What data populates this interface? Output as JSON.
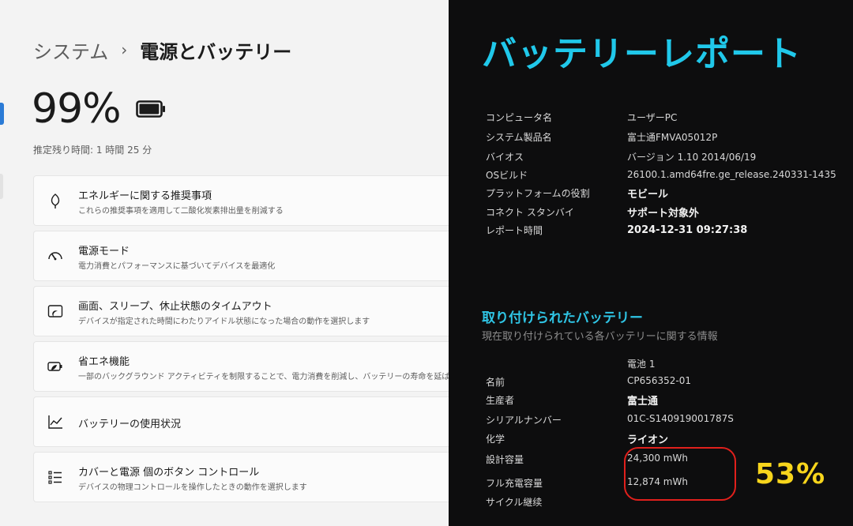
{
  "settings": {
    "breadcrumb": {
      "parent": "システム",
      "separator": "›",
      "current": "電源とバッテリー"
    },
    "battery_percent": "99%",
    "battery_level": 0.99,
    "estimated_remaining": "推定残り時間: 1 時間 25 分",
    "cards": [
      {
        "title": "エネルギーに関する推奨事項",
        "subtitle": "これらの推奨事項を適用して二酸化炭素排出量を削減する",
        "icon": "leaf-icon"
      },
      {
        "title": "電源モード",
        "subtitle": "電力消費とパフォーマンスに基づいてデバイスを最適化",
        "icon": "power-mode-gauge-icon"
      },
      {
        "title": "画面、スリープ、休止状態のタイムアウト",
        "subtitle": "デバイスが指定された時間にわたりアイドル状態になった場合の動作を選択します",
        "icon": "screen-sleep-icon"
      },
      {
        "title": "省エネ機能",
        "subtitle": "一部のバックグラウンド アクティビティを制限することで、電力消費を削減し、バッテリーの寿命を延ばす",
        "icon": "energy-saver-icon"
      },
      {
        "title": "バッテリーの使用状況",
        "subtitle": "",
        "icon": "usage-chart-icon"
      },
      {
        "title": "カバーと電源 個のボタン コントロール",
        "subtitle": "デバイスの物理コントロールを操作したときの動作を選択します",
        "icon": "button-controls-icon"
      }
    ]
  },
  "report": {
    "title": "バッテリーレポート",
    "system_info": [
      {
        "label": "コンピュータ名",
        "value": "ユーザーPC",
        "bold": false
      },
      {
        "label": "システム製品名",
        "value": "富士通FMVA05012P",
        "bold": false
      },
      {
        "label": "バイオス",
        "value": "バージョン 1.10 2014/06/19",
        "bold": false
      },
      {
        "label": "OSビルド",
        "value": "26100.1.amd64fre.ge_release.240331-1435",
        "bold": false
      },
      {
        "label": "プラットフォームの役割",
        "value": "モビール",
        "bold": true
      },
      {
        "label": "コネクト スタンバイ",
        "value": "サポート対象外",
        "bold": true
      },
      {
        "label": "レポート時間",
        "value": "2024-12-31 09:27:38",
        "bold": true
      }
    ],
    "installed_title": "取り付けられたバッテリー",
    "installed_subtitle": "現在取り付けられている各バッテリーに関する情報",
    "battery_column": "電池 1",
    "battery_info": [
      {
        "label": "名前",
        "value": "CP656352-01",
        "bold": false
      },
      {
        "label": "生産者",
        "value": "富士通",
        "bold": true
      },
      {
        "label": "シリアルナンバー",
        "value": "01C-S140919001787S",
        "bold": false
      },
      {
        "label": "化学",
        "value": "ライオン",
        "bold": true
      },
      {
        "label": "設計容量",
        "value": "24,300 mWh",
        "bold": false
      },
      {
        "label": "フル充電容量",
        "value": "12,874 mWh",
        "bold": false
      },
      {
        "label": "サイクル継续",
        "value": "",
        "bold": false
      }
    ],
    "capacity_ratio": "53%"
  },
  "colors": {
    "report_accent": "#20c8ea",
    "highlight_ring": "#e0201c",
    "ratio_text": "#f7d51c"
  }
}
